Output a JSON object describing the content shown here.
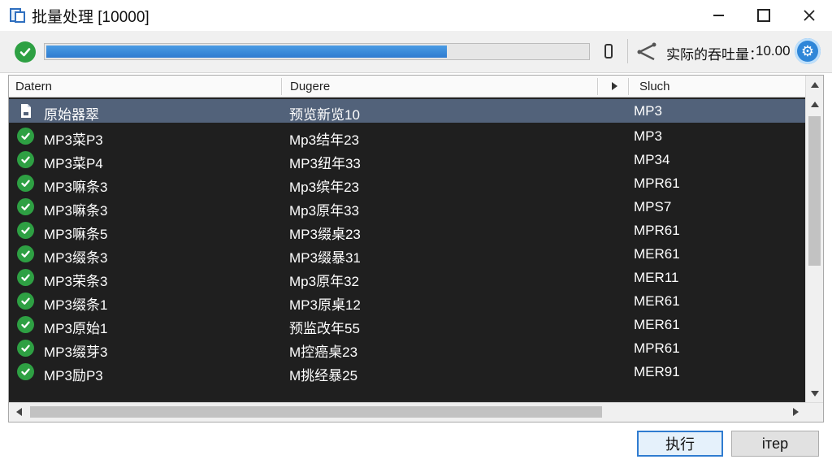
{
  "window": {
    "title": "批量处理 [10000]"
  },
  "toolbar": {
    "progress_percent": 74,
    "speed_label": "实际的吞吐量：",
    "speed_value": "10.00",
    "gear_glyph": "⚙"
  },
  "columns": [
    {
      "label": "Datern"
    },
    {
      "label": "Dugere"
    },
    {
      "label": "Sluch"
    }
  ],
  "rows": [
    {
      "icon": "document-icon",
      "c1": "原始器翠",
      "c2": "预览新览10",
      "c3": "MP3",
      "selected": true
    },
    {
      "icon": "check-icon",
      "c1": "MP3菜P3",
      "c2": "Mp3结年23",
      "c3": "MP3"
    },
    {
      "icon": "check-icon",
      "c1": "MP3菜P4",
      "c2": "MP3纽年33",
      "c3": "MP34"
    },
    {
      "icon": "check-icon",
      "c1": "MP3嘛条3",
      "c2": "Mp3缤年23",
      "c3": "MPR61"
    },
    {
      "icon": "check-icon",
      "c1": "MP3嘛条3",
      "c2": "Mp3原年33",
      "c3": "MPS7"
    },
    {
      "icon": "check-icon",
      "c1": "MP3嘛条5",
      "c2": "MP3缀桌23",
      "c3": "MPR61"
    },
    {
      "icon": "check-icon",
      "c1": "MP3缀条3",
      "c2": "MP3缀暴31",
      "c3": "MER61"
    },
    {
      "icon": "check-icon",
      "c1": "MP3荣条3",
      "c2": "Mp3原年32",
      "c3": "MER11"
    },
    {
      "icon": "check-icon",
      "c1": "MP3缀条1",
      "c2": "MP3原桌12",
      "c3": "MER61"
    },
    {
      "icon": "check-icon",
      "c1": "MP3原始1",
      "c2": "预监改年55",
      "c3": "MER61"
    },
    {
      "icon": "check-icon",
      "c1": "MP3缀芽3",
      "c2": "M控癌桌23",
      "c3": "MPR61"
    },
    {
      "icon": "check-icon",
      "c1": "MP3励P3",
      "c2": "M挑经暴25",
      "c3": "MER91"
    }
  ],
  "footer": {
    "execute_label": "执行",
    "stop_label": "iтep"
  }
}
